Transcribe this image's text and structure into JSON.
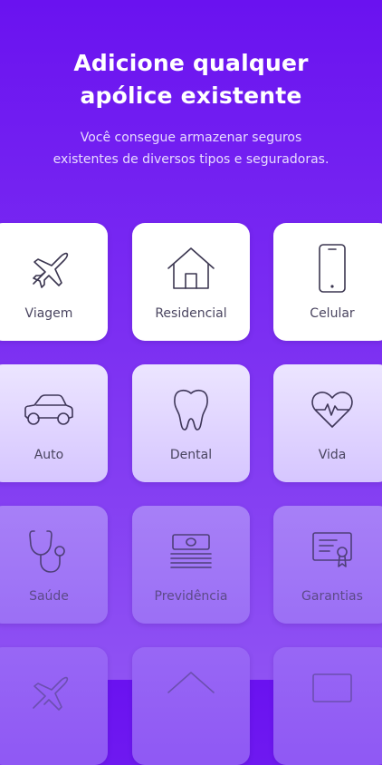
{
  "hero": {
    "title": "Adicione qualquer\napólice existente",
    "subtitle": "Você consegue armazenar seguros\nexistentes de diversos tipos e seguradoras."
  },
  "categories": [
    {
      "label": "Viagem",
      "icon": "airplane-icon"
    },
    {
      "label": "Residencial",
      "icon": "house-icon"
    },
    {
      "label": "Celular",
      "icon": "smartphone-icon"
    },
    {
      "label": "Auto",
      "icon": "car-icon"
    },
    {
      "label": "Dental",
      "icon": "tooth-icon"
    },
    {
      "label": "Vida",
      "icon": "heart-pulse-icon"
    },
    {
      "label": "Saúde",
      "icon": "stethoscope-icon"
    },
    {
      "label": "Previdência",
      "icon": "money-stack-icon"
    },
    {
      "label": "Garantias",
      "icon": "certificate-icon"
    }
  ],
  "colors": {
    "background_top": "#6a12f0",
    "background_bottom": "#8f52f3",
    "tile_active": "#ffffff",
    "label_text": "#4a4560"
  }
}
